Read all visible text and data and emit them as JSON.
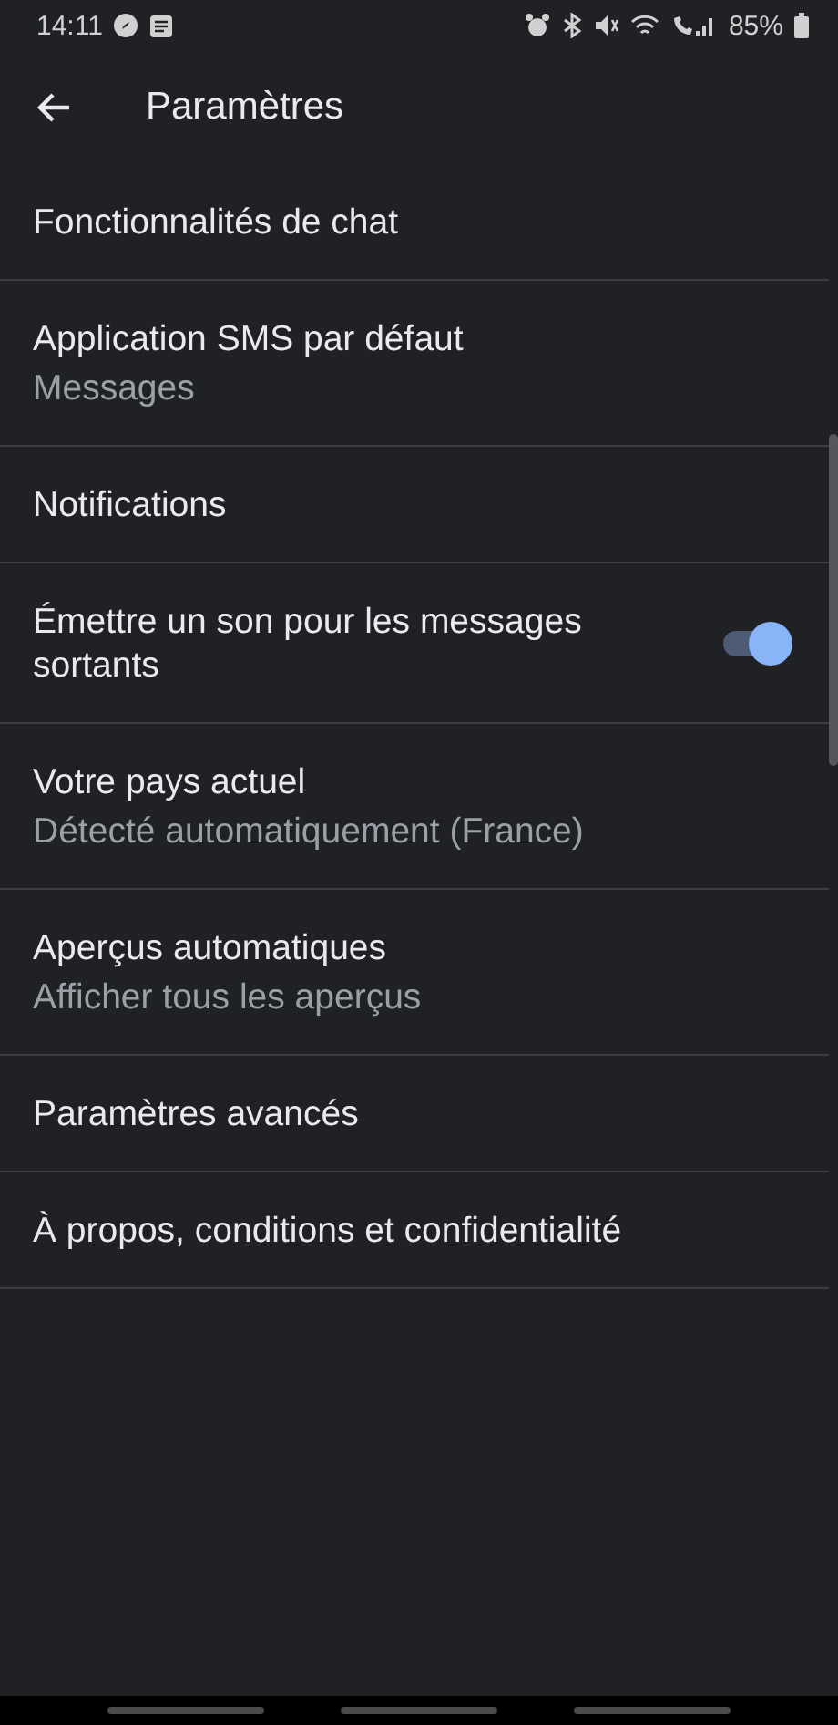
{
  "status_bar": {
    "time": "14:11",
    "battery": "85%"
  },
  "app_bar": {
    "title": "Paramètres"
  },
  "items": [
    {
      "kind": "plain",
      "title": "Fonctionnalités de chat"
    },
    {
      "kind": "subtitle",
      "title": "Application SMS par défaut",
      "subtitle": "Messages"
    },
    {
      "kind": "plain",
      "title": "Notifications"
    },
    {
      "kind": "toggle",
      "title": "Émettre un son pour les messages sortants",
      "on": true
    },
    {
      "kind": "subtitle",
      "title": "Votre pays actuel",
      "subtitle": "Détecté automatiquement (France)"
    },
    {
      "kind": "subtitle",
      "title": "Aperçus automatiques",
      "subtitle": "Afficher tous les aperçus"
    },
    {
      "kind": "plain",
      "title": "Paramètres avancés"
    },
    {
      "kind": "plain",
      "title": "À propos, conditions et confidentialité"
    }
  ]
}
